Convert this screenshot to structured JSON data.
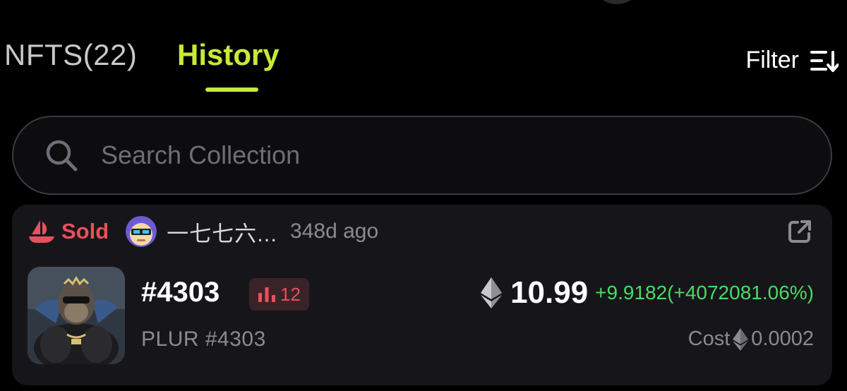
{
  "tabs": {
    "nfts_label": "NFTS(22)",
    "history_label": "History"
  },
  "filter": {
    "label": "Filter",
    "icon": "sort-filter-icon"
  },
  "search": {
    "placeholder": "Search Collection",
    "value": "",
    "icon": "search-icon"
  },
  "activity": {
    "event_label": "Sold",
    "event_icon": "opensea-boat-icon",
    "user_name": "一七七六...",
    "time_ago": "348d ago",
    "token_id": "#4303",
    "rank": "12",
    "collection_name": "PLUR #4303",
    "price": "10.99",
    "price_change": "+9.9182(+4072081.06%)",
    "cost_label": "Cost",
    "cost_value": "0.0002"
  },
  "colors": {
    "accent": "#c5ea38",
    "sold": "#e8505b",
    "gain": "#4cd964",
    "muted": "#8a8a90"
  }
}
